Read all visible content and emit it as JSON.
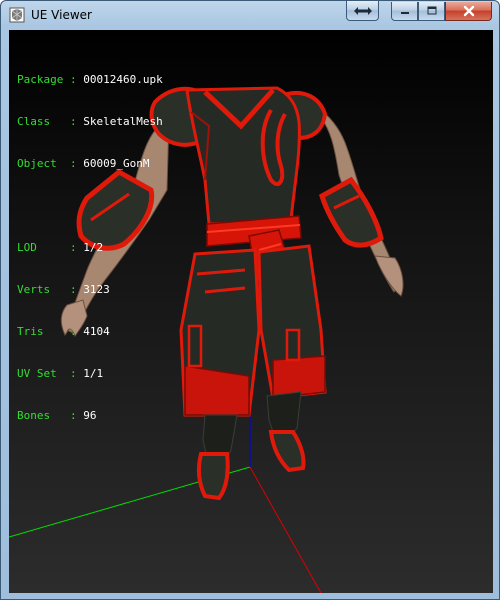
{
  "window": {
    "title": "UE Viewer"
  },
  "titlebar_buttons": {
    "swap_icon": "swap-arrows-icon",
    "minimize_icon": "minimize-icon",
    "maximize_icon": "maximize-icon",
    "close_icon": "close-icon"
  },
  "info": {
    "package": {
      "key": "Package : ",
      "value": "00012460.upk"
    },
    "class": {
      "key": "Class   : ",
      "value": "SkeletalMesh"
    },
    "object": {
      "key": "Object  : ",
      "value": "60009_GonM"
    },
    "lod": {
      "key": "LOD     : ",
      "value": "1/2"
    },
    "verts": {
      "key": "Verts   : ",
      "value": "3123"
    },
    "tris": {
      "key": "Tris    : ",
      "value": "4104"
    },
    "uvset": {
      "key": "UV Set  : ",
      "value": "1/1"
    },
    "bones": {
      "key": "Bones   : ",
      "value": "96"
    }
  },
  "colors": {
    "label_green": "#33dd33",
    "value_white": "#ffffff",
    "axis_x": "#00dd00",
    "axis_y": "#dd0000",
    "axis_z": "#0000ee",
    "armor_red": "#e01a0a",
    "cloth_dark": "#262a24",
    "skin": "#a88770"
  }
}
